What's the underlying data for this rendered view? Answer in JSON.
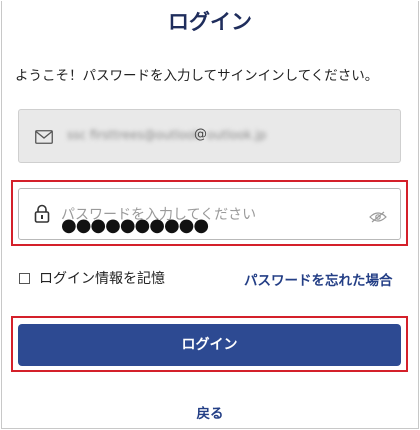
{
  "title": "ログイン",
  "welcome_message": "ようこそ！パスワードを入力してサインインしてください。",
  "email_field": {
    "value_obscured_left": "ssc firsttrees@outlook",
    "at_sign": "@",
    "value_obscured_right": "outlook.jp",
    "icon": "mail-icon"
  },
  "password_field": {
    "placeholder": "パスワードを入力してください",
    "masked_value": "●●●●●●●●●●",
    "icons": [
      "lock-icon",
      "eye-icon"
    ]
  },
  "remember_me": {
    "label": "ログイン情報を記憶",
    "checked": false
  },
  "forgot_password_link": "パスワードを忘れた場合",
  "login_button": "ログイン",
  "back_link": "戻る",
  "colors": {
    "title": "#1f2d5c",
    "link": "#243f86",
    "button": "#2d4a92",
    "highlight": "#d4202a",
    "email_bg": "#e9e9e9"
  }
}
